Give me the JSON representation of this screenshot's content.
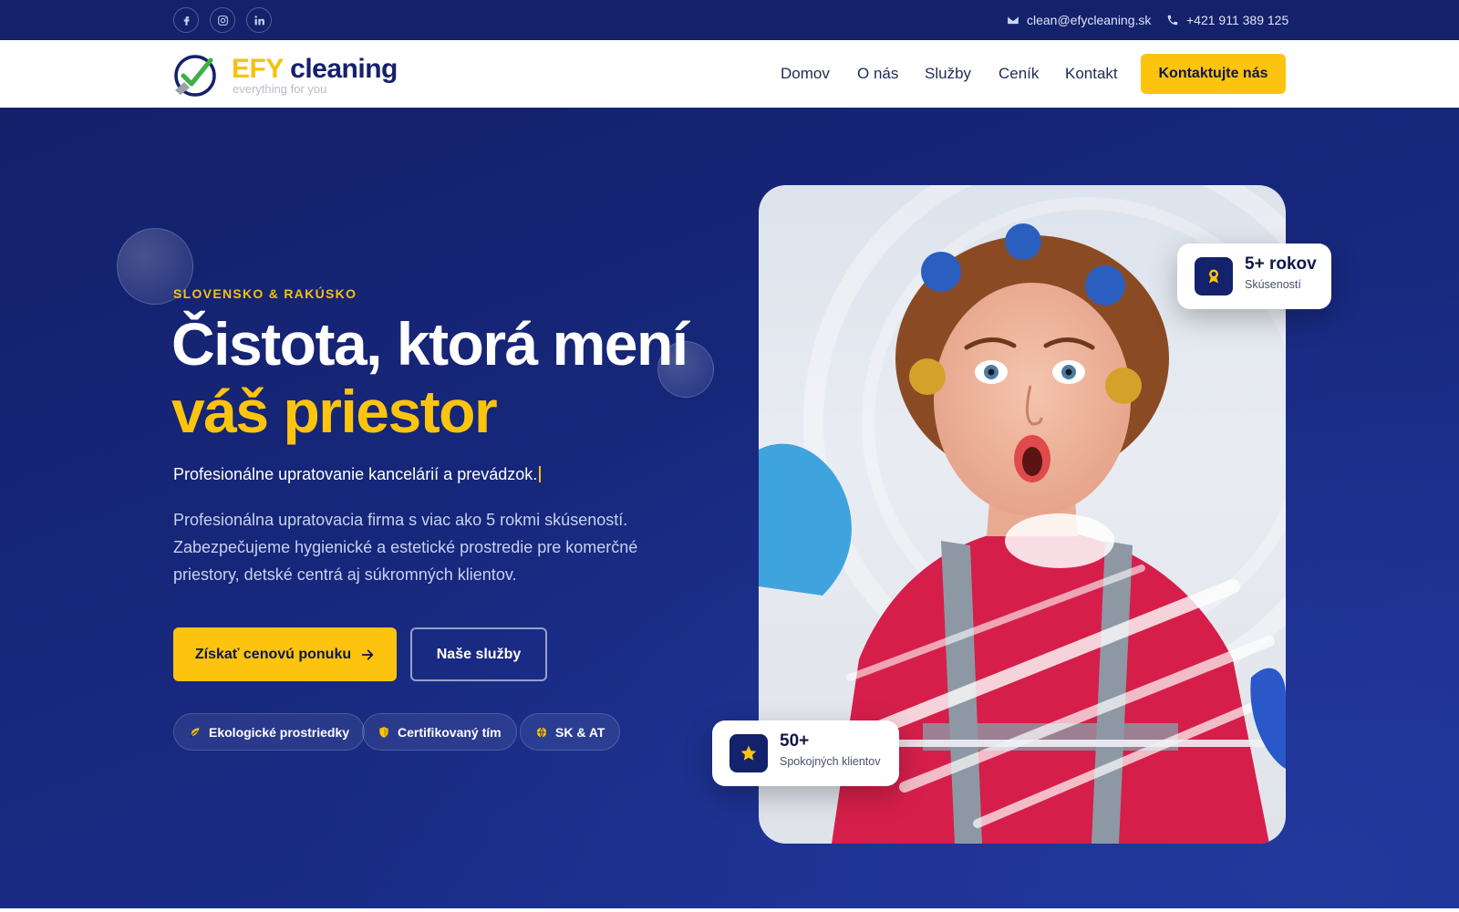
{
  "topbar": {
    "social": [
      {
        "name": "facebook-icon",
        "glyph": "f"
      },
      {
        "name": "instagram-icon",
        "glyph": "ig"
      },
      {
        "name": "linkedin-icon",
        "glyph": "in"
      }
    ],
    "email": "clean@efycleaning.sk",
    "phone": "+421 911 389 125"
  },
  "header": {
    "logo_efy": "EFY",
    "logo_cleaning": "cleaning",
    "logo_tagline": "everything for you",
    "nav": [
      "Domov",
      "O nás",
      "Služby",
      "Ceník",
      "Kontakt"
    ],
    "cta": "Kontaktujte nás"
  },
  "hero": {
    "kicker": "SLOVENSKO & RAKÚSKO",
    "title_line1": "Čistota, ktorá mení",
    "title_line2": "váš priestor",
    "typed_text": "Profesionálne upratovanie kancelárií a prevádzok.",
    "description": "Profesionálna upratovacia firma s viac ako 5 rokmi skúseností. Zabezpečujeme hygienické a estetické prostredie pre komerčné priestory, detské centrá aj súkromných klientov.",
    "primary_button": "Získať cenovú ponuku",
    "secondary_button": "Naše služby",
    "chips": [
      "Ekologické prostriedky",
      "Certifikovaný tím",
      "SK & AT"
    ]
  },
  "stats": {
    "experience_value": "5+ rokov",
    "experience_label": "Skúseností",
    "clients_value": "50+",
    "clients_label": "Spokojných klientov"
  },
  "colors": {
    "navy": "#14216b",
    "accent": "#fcc40f",
    "white": "#ffffff"
  }
}
